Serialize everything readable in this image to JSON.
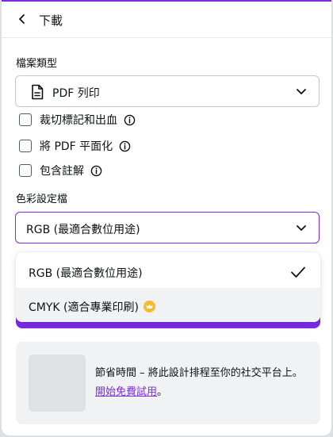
{
  "header": {
    "title": "下載"
  },
  "file_type": {
    "label": "檔案類型",
    "selected": "PDF 列印"
  },
  "options": [
    {
      "label": "裁切標記和出血",
      "checked": false
    },
    {
      "label": "將 PDF 平面化",
      "checked": false
    },
    {
      "label": "包含註解",
      "checked": false
    }
  ],
  "color_profile": {
    "label": "色彩設定檔",
    "selected": "RGB (最適合數位用途)",
    "dropdown": [
      {
        "label": "RGB (最適合數位用途)",
        "selected": true
      },
      {
        "label": "CMYK (適合專業印刷)",
        "premium": true
      }
    ]
  },
  "promo": {
    "text": "節省時間 – 將此設計排程至你的社交平台上。",
    "link": "開始免費試用",
    "suffix": "。"
  },
  "colors": {
    "accent": "#7d2ae8",
    "crown": "#f8b92c"
  }
}
